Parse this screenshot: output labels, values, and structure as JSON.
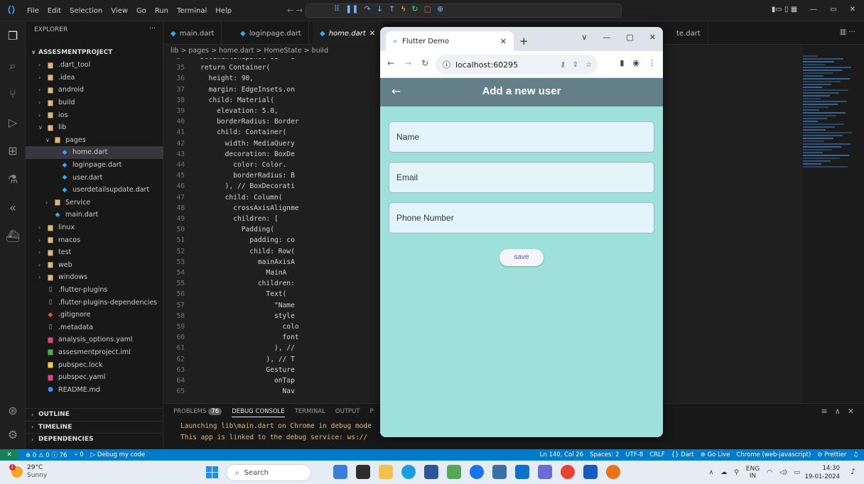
{
  "titlebar": {
    "menu": [
      "File",
      "Edit",
      "Selection",
      "View",
      "Go",
      "Run",
      "Terminal",
      "Help"
    ]
  },
  "explorer": {
    "header": "EXPLORER",
    "project": "ASSESMENTPROJECT",
    "items": [
      {
        "label": ".dart_tool",
        "kind": "folder",
        "level": 1,
        "open": false
      },
      {
        "label": ".idea",
        "kind": "folder",
        "level": 1,
        "open": false
      },
      {
        "label": "android",
        "kind": "folder",
        "level": 1,
        "open": false
      },
      {
        "label": "build",
        "kind": "folder",
        "level": 1,
        "open": false
      },
      {
        "label": "ios",
        "kind": "folder",
        "level": 1,
        "open": false
      },
      {
        "label": "lib",
        "kind": "folder",
        "level": 1,
        "open": true
      },
      {
        "label": "pages",
        "kind": "folder",
        "level": 2,
        "open": true
      },
      {
        "label": "home.dart",
        "kind": "dart",
        "level": 3,
        "selected": true
      },
      {
        "label": "loginpage.dart",
        "kind": "dart",
        "level": 3
      },
      {
        "label": "user.dart",
        "kind": "dart",
        "level": 3
      },
      {
        "label": "userdetailsupdate.dart",
        "kind": "dart",
        "level": 3
      },
      {
        "label": "Service",
        "kind": "folder",
        "level": 2,
        "open": false
      },
      {
        "label": "main.dart",
        "kind": "dart",
        "level": 2
      },
      {
        "label": "linux",
        "kind": "folder",
        "level": 1,
        "open": false
      },
      {
        "label": "macos",
        "kind": "folder",
        "level": 1,
        "open": false
      },
      {
        "label": "test",
        "kind": "folder",
        "level": 1,
        "open": false
      },
      {
        "label": "web",
        "kind": "folder",
        "level": 1,
        "open": false
      },
      {
        "label": "windows",
        "kind": "folder",
        "level": 1,
        "open": false
      },
      {
        "label": ".flutter-plugins",
        "kind": "file",
        "level": 1
      },
      {
        "label": ".flutter-plugins-dependencies",
        "kind": "file",
        "level": 1
      },
      {
        "label": ".gitignore",
        "kind": "git",
        "level": 1
      },
      {
        "label": ".metadata",
        "kind": "file",
        "level": 1
      },
      {
        "label": "analysis_options.yaml",
        "kind": "yaml",
        "level": 1
      },
      {
        "label": "assesmentproject.iml",
        "kind": "iml",
        "level": 1
      },
      {
        "label": "pubspec.lock",
        "kind": "lock",
        "level": 1
      },
      {
        "label": "pubspec.yaml",
        "kind": "yaml",
        "level": 1
      },
      {
        "label": "README.md",
        "kind": "info",
        "level": 1
      }
    ],
    "sections": [
      "OUTLINE",
      "TIMELINE",
      "DEPENDENCIES"
    ]
  },
  "tabs": [
    {
      "label": "main.dart",
      "active": false
    },
    {
      "label": "loginpage.dart",
      "active": false
    },
    {
      "label": "home.dart",
      "active": true
    },
    {
      "label": "te.dart",
      "active": false
    }
  ],
  "breadcrumb": "lib > pages > home.dart > HomeState > build",
  "editor": {
    "first_line": 34,
    "lines": [
      "DocumentSnapshot ds = s",
      "return Container(",
      "  height: 90,",
      "  margin: EdgeInsets.on",
      "  child: Material(",
      "    elevation: 5.0,",
      "    borderRadius: Border",
      "    child: Container(",
      "      width: MediaQuery",
      "      decoration: BoxDe",
      "        color: Color.",
      "        borderRadius: B",
      "      ), // BoxDecorati",
      "      child: Column(",
      "        crossAxisAlignme",
      "        children: [",
      "          Padding(",
      "            padding: co",
      "            child: Row(",
      "              mainAxisA",
      "                MainA",
      "              children:",
      "                Text(",
      "                  \"Name",
      "                  style",
      "                    colo",
      "                    font",
      "                  ), //",
      "                ), // T",
      "                Gesture",
      "                  onTap",
      "                    Nav"
    ]
  },
  "panel": {
    "tabs": [
      "PROBLEMS",
      "DEBUG CONSOLE",
      "TERMINAL",
      "OUTPUT",
      "P"
    ],
    "problems_count": "76",
    "output": [
      "Launching lib\\main.dart on Chrome in debug mode",
      "This app is linked to the debug service: ws://"
    ]
  },
  "statusbar": {
    "errors": "0",
    "warnings": "0",
    "infos": "76",
    "ports": "0",
    "debug": "Debug my code",
    "position": "Ln 140, Col 26",
    "spaces": "Spaces: 2",
    "encoding": "UTF-8",
    "eol": "CRLF",
    "language": "{} Dart",
    "golive": "Go Live",
    "device": "Chrome (web-javascript)",
    "prettier": "Prettier"
  },
  "browser": {
    "tab_title": "Flutter Demo",
    "url": "localhost:60295",
    "app_title": "Add a new user",
    "fields": [
      {
        "placeholder": "Name"
      },
      {
        "placeholder": "Email"
      },
      {
        "placeholder": "Phone Number"
      }
    ],
    "save_label": "save",
    "colors": {
      "appbar": "#638089",
      "body": "#9ee0da",
      "field": "#e3f4fb"
    }
  },
  "taskbar": {
    "weather_badge": "1",
    "temp": "29°C",
    "condition": "Sunny",
    "search": "Search",
    "lang": "ENG",
    "region": "IN",
    "time": "14:30",
    "date": "19-01-2024"
  }
}
